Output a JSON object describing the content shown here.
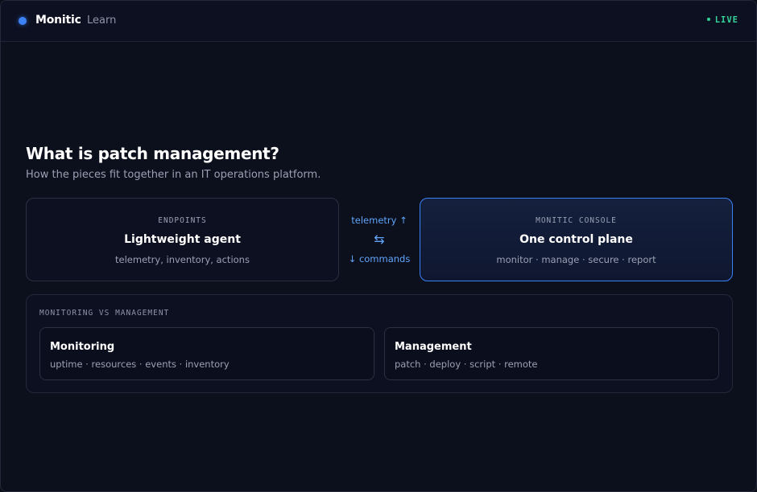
{
  "header": {
    "brand": "Monitic",
    "nav_learn": "Learn",
    "live": "LIVE"
  },
  "main": {
    "title": "What is patch management?",
    "subtitle": "How the pieces fit together in an IT operations platform."
  },
  "endpoints": {
    "label": "ENDPOINTS",
    "title": "Lightweight agent",
    "sub": "telemetry, inventory, actions"
  },
  "flow": {
    "up": "telemetry ↑",
    "icon": "⇆",
    "down": "↓ commands"
  },
  "console": {
    "label": "MONITIC CONSOLE",
    "title": "One control plane",
    "sub": "monitor · manage · secure · report"
  },
  "comparison": {
    "label": "MONITORING VS MANAGEMENT",
    "monitoring": {
      "title": "Monitoring",
      "items": "uptime · resources · events · inventory"
    },
    "management": {
      "title": "Management",
      "items": "patch · deploy · script · remote"
    }
  },
  "colors": {
    "accent": "#3b82f6",
    "live": "#34d399",
    "background": "#0c0f1c"
  }
}
